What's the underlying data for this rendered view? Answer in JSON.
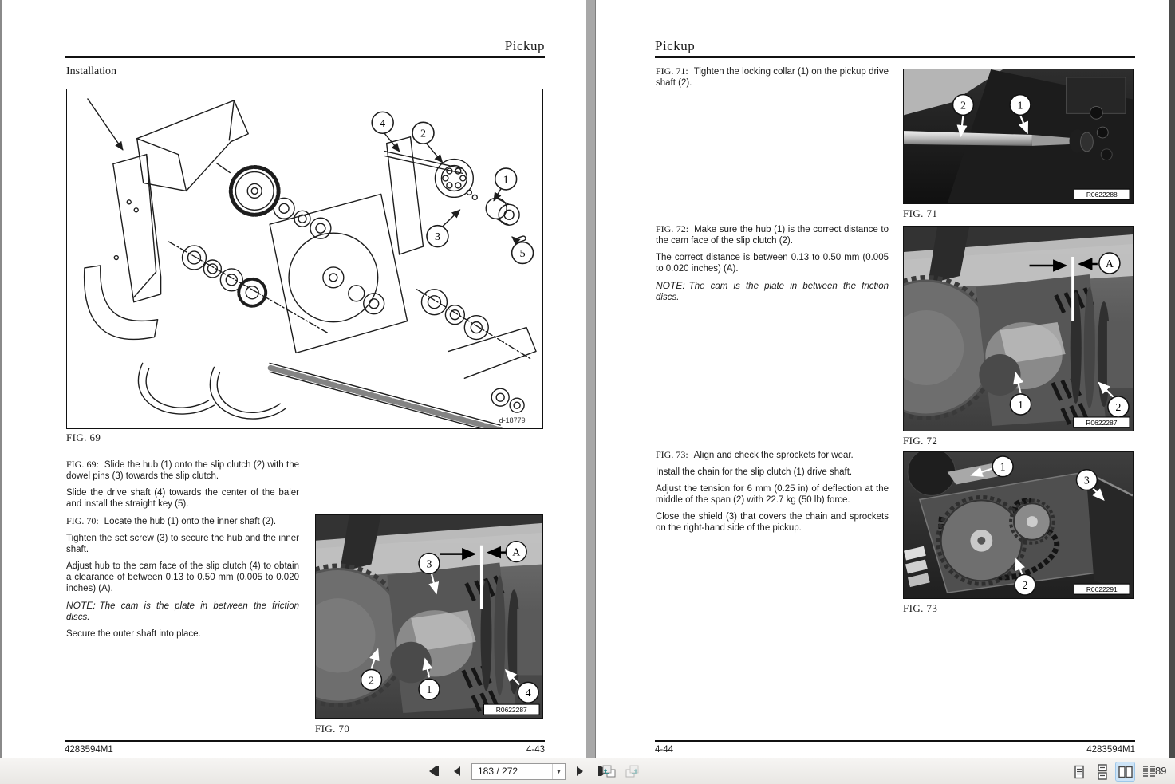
{
  "left_page": {
    "header": "Pickup",
    "section_title": "Installation",
    "figure69": {
      "caption": "FIG. 69",
      "code": "d-18779",
      "callouts": {
        "c4": "4",
        "c2": "2",
        "c1": "1",
        "c3": "3",
        "c5": "5"
      }
    },
    "body": [
      {
        "lead": "FIG. 69:",
        "text": "Slide the hub (1) onto the slip clutch (2) with the dowel pins (3) towards the slip clutch."
      },
      {
        "lead": "",
        "text": "Slide the drive shaft (4) towards the center of the baler and install the straight key (5)."
      },
      {
        "lead": "FIG. 70:",
        "text": "Locate the hub (1) onto the inner shaft (2)."
      },
      {
        "lead": "",
        "text": "Tighten the set screw (3) to secure the hub and the inner shaft."
      },
      {
        "lead": "",
        "text": "Adjust hub to the cam face of the slip clutch (4) to obtain a clearance of between 0.13 to 0.50 mm (0.005 to 0.020 inches) (A)."
      },
      {
        "lead": "NOTE:",
        "text": "The cam is the plate in between the friction discs."
      },
      {
        "lead": "",
        "text": "Secure the outer shaft into place."
      }
    ],
    "figure70": {
      "caption": "FIG. 70",
      "code": "R0622287",
      "callouts": {
        "c3": "3",
        "cA": "A",
        "c2": "2",
        "c1": "1",
        "c4": "4"
      }
    },
    "footer": {
      "left": "4283594M1",
      "right": "4-43"
    }
  },
  "right_page": {
    "header": "Pickup",
    "fig71_paragraphs": [
      {
        "lead": "FIG. 71:",
        "text": "Tighten the locking collar (1) on the pickup drive shaft (2)."
      }
    ],
    "figure71": {
      "caption": "FIG. 71",
      "code": "R0622288",
      "callouts": {
        "c2": "2",
        "c1": "1"
      }
    },
    "fig72_paragraphs": [
      {
        "lead": "FIG. 72:",
        "text": "Make sure the hub (1) is the correct distance to the cam face of the slip clutch (2)."
      },
      {
        "lead": "",
        "text": "The correct distance is between 0.13 to 0.50 mm (0.005 to 0.020 inches) (A)."
      },
      {
        "lead": "NOTE:",
        "text": "The cam is the plate in between the friction discs."
      }
    ],
    "figure72": {
      "caption": "FIG. 72",
      "code": "R0622287",
      "callouts": {
        "cA": "A",
        "c1": "1",
        "c2": "2"
      }
    },
    "fig73_paragraphs": [
      {
        "lead": "FIG. 73:",
        "text": "Align and check the sprockets for wear."
      },
      {
        "lead": "",
        "text": "Install the chain for the slip clutch (1) drive shaft."
      },
      {
        "lead": "",
        "text": "Adjust the tension for 6 mm (0.25 in) of deflection at the middle of the span (2) with 22.7 kg (50 lb) force."
      },
      {
        "lead": "",
        "text": "Close the shield (3) that covers the chain and sprockets on the right-hand side of the pickup."
      }
    ],
    "figure73": {
      "caption": "FIG. 73",
      "code": "R0622291",
      "callouts": {
        "c1": "1",
        "c3": "3",
        "c2": "2"
      }
    },
    "footer": {
      "left": "4-44",
      "right": "4283594M1"
    }
  },
  "toolbar": {
    "page_value": "183 / 272",
    "zoom_value": "89",
    "colors": {
      "accent_selected": "#cde4f7",
      "view_arrow": "#2e8b8b"
    }
  }
}
